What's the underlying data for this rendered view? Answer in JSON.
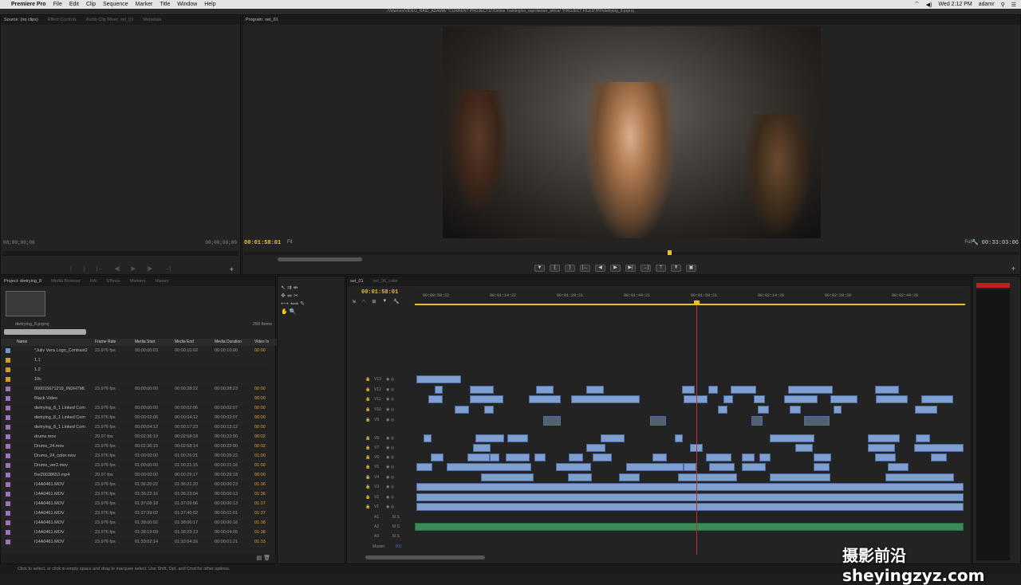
{
  "menubar": {
    "app": "Premiere Pro",
    "items": [
      "File",
      "Edit",
      "Clip",
      "Sequence",
      "Marker",
      "Title",
      "Window",
      "Help"
    ],
    "clock": "Wed 2:12 PM",
    "user": "adamr"
  },
  "window_title": "/Volumes/VIDEO_RAID_ADAMR/ *CURRENT PROJECTS*/Online Training/vo_reproterser_africa/ *PROJECT FILES*/PP/dietrying_8.prproj",
  "source_panel": {
    "tabs": [
      "Source: (no clips)",
      "Effect Controls",
      "Audio Clip Mixer: set_01",
      "Metadata"
    ],
    "tc_left": "00;00;00;00",
    "tc_right": "00;00;00;00"
  },
  "program_panel": {
    "tab": "Program: set_01",
    "tc_current": "00:01:58:01",
    "fit": "Fit",
    "quality": "Full",
    "tc_duration": "00:33:03:06"
  },
  "project_panel": {
    "tabs": [
      "Project: dietrying_8",
      "Media Browser",
      "Info",
      "Effects",
      "Markers",
      "History"
    ],
    "project_name": "dietrying_8.prproj",
    "item_count": "258 Items",
    "columns": [
      "Name",
      "Frame Rate",
      "Media Start",
      "Media End",
      "Media Duration",
      "Video In"
    ],
    "rows": [
      {
        "name": "*Juliv Vera Logo_Contrast2",
        "rate": "23.976 fps",
        "start": "00:00:00:03",
        "end": "00:00:10:02",
        "dur": "00:00:10:00",
        "vin": "00:00",
        "color": "#6a9ad0"
      },
      {
        "name": "1.1",
        "rate": "",
        "start": "",
        "end": "",
        "dur": "",
        "vin": "",
        "color": "#d09a30"
      },
      {
        "name": "1.2",
        "rate": "",
        "start": "",
        "end": "",
        "dur": "",
        "vin": "",
        "color": "#d09a30"
      },
      {
        "name": "10c",
        "rate": "",
        "start": "",
        "end": "",
        "dur": "",
        "vin": "",
        "color": "#d09a30"
      },
      {
        "name": "000015671219_INDHTML",
        "rate": "23.976 fps",
        "start": "00:00:00:00",
        "end": "00:00:28:22",
        "dur": "00:00:28:23",
        "vin": "00:00",
        "color": "#a070c0"
      },
      {
        "name": "Black Video",
        "rate": "",
        "start": "",
        "end": "",
        "dur": "",
        "vin": "00:00",
        "color": "#a070c0"
      },
      {
        "name": "dietrying_8_1 Linked Com",
        "rate": "23.976 fps",
        "start": "00:00:00:00",
        "end": "00:00:02:06",
        "dur": "00:00:02:07",
        "vin": "00:00",
        "color": "#a070c0"
      },
      {
        "name": "dietrying_8_1 Linked Com",
        "rate": "23.976 fps",
        "start": "00:00:02:06",
        "end": "00:00:04:12",
        "dur": "00:00:02:07",
        "vin": "00:00",
        "color": "#a070c0"
      },
      {
        "name": "dietrying_8_1 Linked Com",
        "rate": "23.976 fps",
        "start": "00:00:04:12",
        "end": "00:00:17:23",
        "dur": "00:00:13:12",
        "vin": "00:00",
        "color": "#a070c0"
      },
      {
        "name": "drums.mov",
        "rate": "29.97 fps",
        "start": "00:02:36:19",
        "end": "00:02:58:18",
        "dur": "00:00:22:00",
        "vin": "00:02",
        "color": "#a070c0"
      },
      {
        "name": "Drums_24.mov",
        "rate": "23.976 fps",
        "start": "00:02:36:15",
        "end": "00:02:58:14",
        "dur": "00:00:22:00",
        "vin": "00:02",
        "color": "#a070c0"
      },
      {
        "name": "Drums_24_color.mov",
        "rate": "23.976 fps",
        "start": "01:00:00:00",
        "end": "01:00:26:21",
        "dur": "00:00:26:22",
        "vin": "01:00",
        "color": "#a070c0"
      },
      {
        "name": "Drums_ver2.mov",
        "rate": "23.976 fps",
        "start": "01:00:00:00",
        "end": "01:00:21:15",
        "dur": "00:00:21:16",
        "vin": "01:00",
        "color": "#a070c0"
      },
      {
        "name": "fire20038653.mp4",
        "rate": "29.97 fps",
        "start": "00:00:00:00",
        "end": "00:00:29:17",
        "dur": "00:00:29:18",
        "vin": "00:00",
        "color": "#a070c0"
      },
      {
        "name": "I14A0461.MOV",
        "rate": "23.976 fps",
        "start": "01:36:20:22",
        "end": "01:36:21:20",
        "dur": "00:00:00:23",
        "vin": "01:36",
        "color": "#a070c0"
      },
      {
        "name": "I14A0461.MOV",
        "rate": "23.976 fps",
        "start": "01:36:22:16",
        "end": "01:36:23:04",
        "dur": "00:00:00:13",
        "vin": "01:36",
        "color": "#a070c0"
      },
      {
        "name": "I14A0461.MOV",
        "rate": "23.976 fps",
        "start": "01:37:08:18",
        "end": "01:37:09:06",
        "dur": "00:00:00:13",
        "vin": "01:37",
        "color": "#a070c0"
      },
      {
        "name": "I14A0461.MOV",
        "rate": "23.976 fps",
        "start": "01:37:39:02",
        "end": "01:37:40:02",
        "dur": "00:00:01:01",
        "vin": "01:37",
        "color": "#a070c0"
      },
      {
        "name": "I14A0461.MOV",
        "rate": "23.976 fps",
        "start": "01:38:00:02",
        "end": "01:38:00:17",
        "dur": "00:00:00:16",
        "vin": "01:38",
        "color": "#a070c0"
      },
      {
        "name": "I14A0461.MOV",
        "rate": "23.976 fps",
        "start": "01:38:19:09",
        "end": "01:38:23:13",
        "dur": "00:00:04:05",
        "vin": "01:38",
        "color": "#a070c0"
      },
      {
        "name": "I14A0461.MOV",
        "rate": "23.976 fps",
        "start": "01:33:02:14",
        "end": "01:33:04:16",
        "dur": "00:00:01:21",
        "vin": "01:33",
        "color": "#a070c0"
      }
    ]
  },
  "timeline": {
    "tabs": [
      "set_01",
      "set_06_color"
    ],
    "tc": "00:01:58:01",
    "ruler": [
      "00:00:59:22",
      "00:01:14:22",
      "00:01:29:21",
      "00:01:44:21",
      "00:01:59:21",
      "00:02:14:20",
      "00:02:29:20",
      "00:02:44:20"
    ],
    "video_tracks": [
      "V13",
      "V12",
      "V11",
      "V10",
      "V9",
      "V8",
      "V7",
      "V6",
      "V5",
      "V4",
      "V3",
      "V2",
      "V1"
    ],
    "audio_tracks": [
      "A1",
      "A2",
      "A3"
    ],
    "master": "Master",
    "master_val": "0.0"
  },
  "status": "Click to select, or click in empty space and drag to marquee select. Use Shift, Opt, and Cmd for other options.",
  "watermark": "摄影前沿 sheyingzyz.com"
}
